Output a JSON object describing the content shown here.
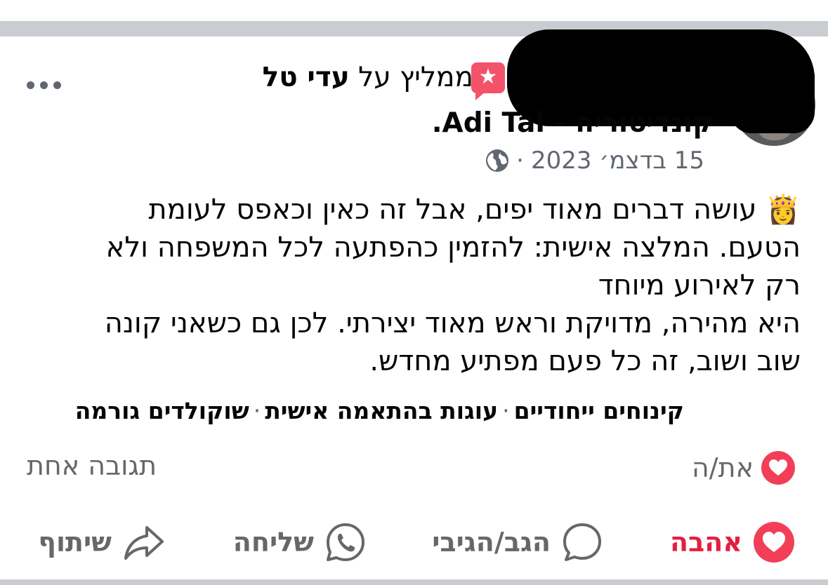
{
  "post": {
    "recommends_label": "ממליץ על",
    "recommender_name": "עדי טל",
    "page_name": "קונדיטוריה - Adi Tal.",
    "date": "15 בדצמ׳ 2023",
    "separator": "·",
    "body_lines": [
      "👸 עושה דברים מאוד יפים, אבל זה כאין וכאפס לעומת",
      "הטעם. המלצה אישית: להזמין כהפתעה לכל המשפחה ולא",
      "רק לאירוע מיוחד",
      "היא מהירה, מדויקת וראש מאוד יצירתי. לכן גם כשאני קונה",
      "שוב ושוב, זה כל פעם מפתיע מחדש."
    ],
    "tags": [
      "קינוחים ייחודיים",
      "עוגות בהתאמה אישית",
      "שוקולדים גורמה"
    ],
    "tag_separator": "·"
  },
  "stats": {
    "reaction_label": "את/ה",
    "comments_label": "תגובה אחת"
  },
  "actions": {
    "love_label": "אהבה",
    "comment_label": "הגב/הגיבי",
    "send_label": "שליחה",
    "share_label": "שיתוף"
  },
  "colors": {
    "accent_red": "#e41e3f",
    "recommend_icon": "#f35369",
    "muted_text": "#65676b",
    "divider": "#c9ccd1"
  },
  "icons": {
    "more": "more-icon",
    "recommend": "star-bubble-icon",
    "privacy": "globe-icon",
    "love": "heart-icon",
    "comment": "comment-icon",
    "send": "whatsapp-icon",
    "share": "share-icon"
  }
}
